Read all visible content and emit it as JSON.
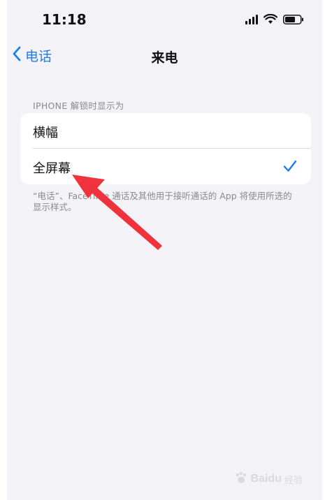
{
  "status_bar": {
    "time": "11:18",
    "icons": [
      "signal-icon",
      "wifi-icon",
      "battery-icon"
    ]
  },
  "nav": {
    "back_label": "电话",
    "title": "来电"
  },
  "settings": {
    "section_header": "IPHONE 解锁时显示为",
    "options": [
      {
        "label": "横幅",
        "selected": false
      },
      {
        "label": "全屏幕",
        "selected": true
      }
    ],
    "footer": "“电话”、FaceTime 通话及其他用于接听通话的 App 将使用所选的显示样式。"
  },
  "annotation": {
    "type": "arrow",
    "color": "#f0323c"
  },
  "watermark": {
    "brand": "Baidu",
    "sub": "经验"
  },
  "colors": {
    "accent": "#1a7cf5",
    "background": "#f2f2f7",
    "card": "#ffffff",
    "secondary_text": "#8a8a8e"
  }
}
